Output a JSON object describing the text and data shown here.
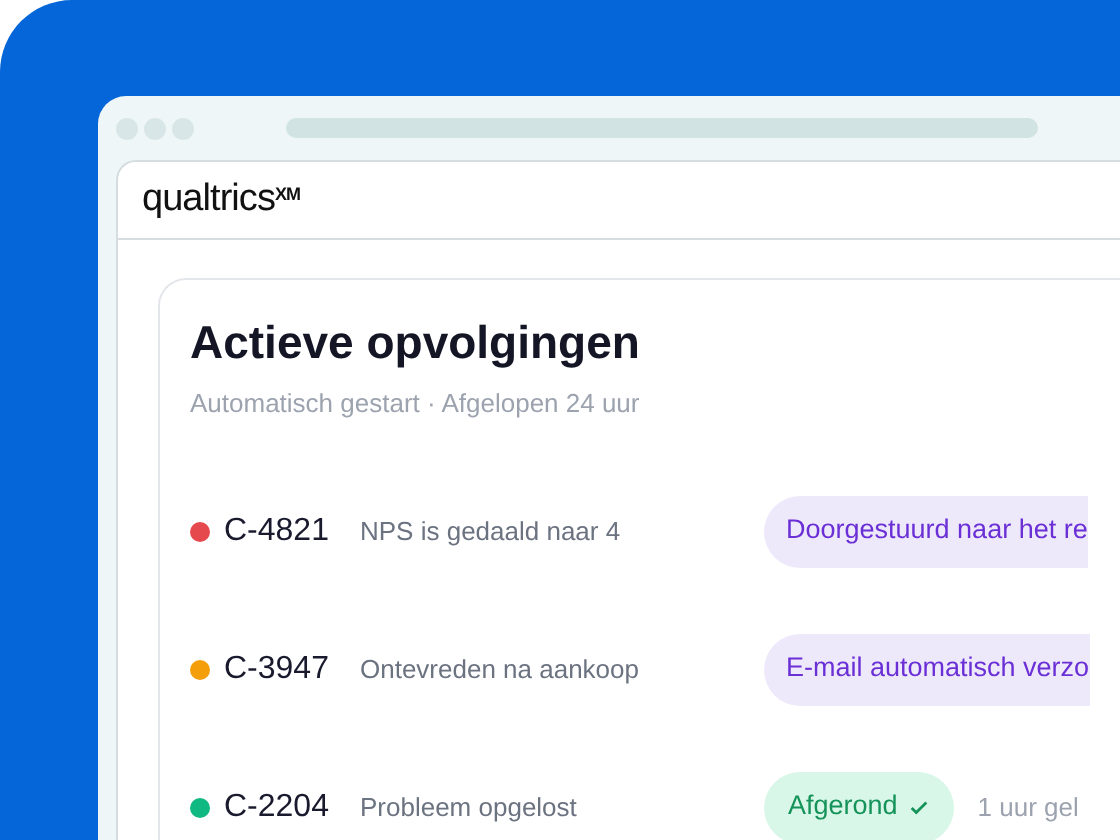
{
  "logo": "qualtrics$^{XM}$",
  "card": {
    "title": "Actieve opvolgingen",
    "subtitle": "Automatisch gestart · Afgelopen 24 uur"
  },
  "rows": [
    {
      "code": "C-4821",
      "description": "NPS is gedaald naar 4",
      "color": "#e5484d",
      "status": {
        "kind": "progress",
        "label": "Doorgestuurd naar het re"
      }
    },
    {
      "code": "C-3947",
      "description": "Ontevreden na aankoop",
      "color": "#f59e0b",
      "status": {
        "kind": "progress",
        "label": "E-mail automatisch verzo"
      }
    },
    {
      "code": "C-2204",
      "description": "Probleem opgelost",
      "color": "#10b981",
      "status": {
        "kind": "done",
        "label": "Afgerond"
      },
      "time": "1 uur gel"
    }
  ]
}
